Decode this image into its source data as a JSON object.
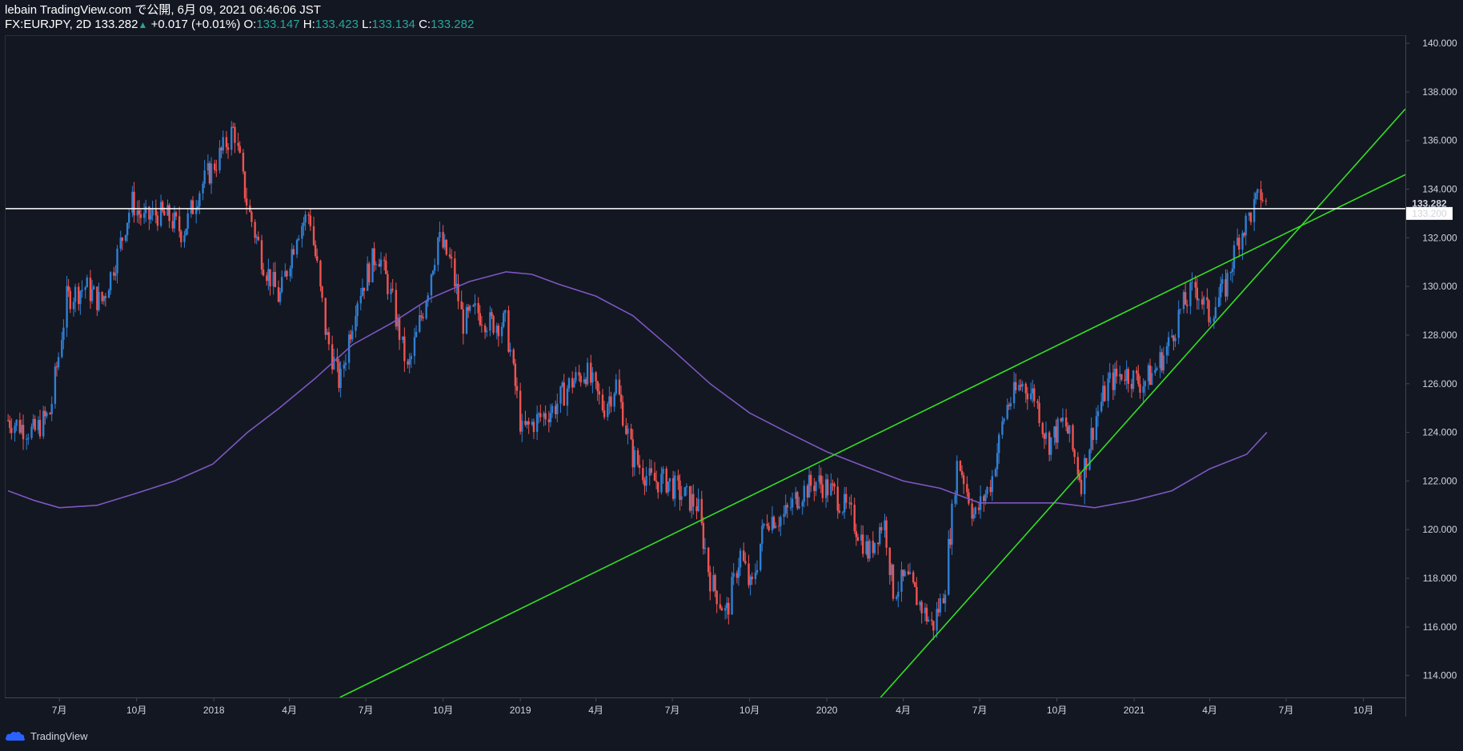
{
  "header": {
    "publish_line": "lebain TradingView.com で公開, 6月 09, 2021 06:46:06 JST",
    "symbol": "FX:EURJPY, 2D",
    "last": "133.282",
    "change": "+0.017 (+0.01%)",
    "o_label": "O:",
    "o_value": "133.147",
    "h_label": "H:",
    "h_value": "133.423",
    "l_label": "L:",
    "l_value": "133.134",
    "c_label": "C:",
    "c_value": "133.282"
  },
  "footer": {
    "brand": "TradingView"
  },
  "colors": {
    "background": "#131722",
    "up": "#2f7fd3",
    "down": "#ef5350",
    "ma": "#7e57c2",
    "trendline": "#34e024",
    "hline": "#ffffff"
  },
  "chart_data": {
    "type": "candlestick",
    "symbol": "FX:EURJPY",
    "interval": "2D",
    "y_ticks": [
      114,
      116,
      118,
      120,
      122,
      124,
      126,
      128,
      130,
      132,
      134,
      136,
      138,
      140
    ],
    "x_ticks": [
      "7月",
      "10月",
      "2018",
      "4月",
      "7月",
      "10月",
      "2019",
      "4月",
      "7月",
      "10月",
      "2020",
      "4月",
      "7月",
      "10月",
      "2021",
      "4月",
      "7月",
      "10月"
    ],
    "x_tick_dates": [
      "2017-07-01",
      "2017-10-01",
      "2018-01-01",
      "2018-04-01",
      "2018-07-01",
      "2018-10-01",
      "2019-01-01",
      "2019-04-01",
      "2019-07-01",
      "2019-10-01",
      "2020-01-01",
      "2020-04-01",
      "2020-07-01",
      "2020-10-01",
      "2021-01-01",
      "2021-04-01",
      "2021-07-01",
      "2021-10-01"
    ],
    "price_labels": [
      {
        "value": 133.282,
        "text": "133.282",
        "style": "current"
      },
      {
        "value": 133.2,
        "text": "133.200",
        "style": "line"
      }
    ],
    "price_path": [
      [
        "2017-05-01",
        124.5
      ],
      [
        "2017-06-01",
        124.0
      ],
      [
        "2017-06-20",
        124.8
      ],
      [
        "2017-07-10",
        129.5
      ],
      [
        "2017-08-01",
        130.0
      ],
      [
        "2017-08-20",
        129.3
      ],
      [
        "2017-09-10",
        131.5
      ],
      [
        "2017-09-25",
        133.5
      ],
      [
        "2017-10-10",
        132.7
      ],
      [
        "2017-10-25",
        133.0
      ],
      [
        "2017-11-10",
        132.8
      ],
      [
        "2017-11-25",
        132.2
      ],
      [
        "2017-12-15",
        134.0
      ],
      [
        "2018-01-10",
        135.5
      ],
      [
        "2018-01-25",
        136.5
      ],
      [
        "2018-02-10",
        133.3
      ],
      [
        "2018-03-01",
        131.0
      ],
      [
        "2018-03-20",
        129.5
      ],
      [
        "2018-04-10",
        132.3
      ],
      [
        "2018-04-25",
        133.0
      ],
      [
        "2018-05-15",
        128.0
      ],
      [
        "2018-05-31",
        126.0
      ],
      [
        "2018-06-20",
        129.5
      ],
      [
        "2018-07-15",
        131.5
      ],
      [
        "2018-08-01",
        129.5
      ],
      [
        "2018-08-20",
        126.5
      ],
      [
        "2018-09-10",
        129.5
      ],
      [
        "2018-09-25",
        132.0
      ],
      [
        "2018-10-10",
        131.0
      ],
      [
        "2018-10-25",
        128.5
      ],
      [
        "2018-11-10",
        129.0
      ],
      [
        "2018-11-25",
        128.5
      ],
      [
        "2018-12-15",
        128.5
      ],
      [
        "2019-01-03",
        124.0
      ],
      [
        "2019-01-20",
        124.5
      ],
      [
        "2019-02-10",
        125.0
      ],
      [
        "2019-03-01",
        126.0
      ],
      [
        "2019-03-20",
        126.5
      ],
      [
        "2019-04-10",
        125.0
      ],
      [
        "2019-04-25",
        126.0
      ],
      [
        "2019-05-15",
        123.0
      ],
      [
        "2019-06-05",
        122.0
      ],
      [
        "2019-06-25",
        122.0
      ],
      [
        "2019-07-10",
        121.5
      ],
      [
        "2019-07-31",
        121.0
      ],
      [
        "2019-08-15",
        118.0
      ],
      [
        "2019-09-03",
        116.5
      ],
      [
        "2019-09-20",
        119.0
      ],
      [
        "2019-10-03",
        117.5
      ],
      [
        "2019-10-20",
        120.5
      ],
      [
        "2019-11-10",
        120.5
      ],
      [
        "2019-11-30",
        121.5
      ],
      [
        "2019-12-20",
        122.0
      ],
      [
        "2020-01-10",
        121.5
      ],
      [
        "2020-01-31",
        120.5
      ],
      [
        "2020-02-20",
        119.0
      ],
      [
        "2020-03-09",
        120.5
      ],
      [
        "2020-03-20",
        117.5
      ],
      [
        "2020-04-05",
        118.0
      ],
      [
        "2020-04-20",
        117.0
      ],
      [
        "2020-05-06",
        116.0
      ],
      [
        "2020-05-20",
        117.5
      ],
      [
        "2020-06-05",
        123.0
      ],
      [
        "2020-06-25",
        120.5
      ],
      [
        "2020-07-15",
        122.0
      ],
      [
        "2020-08-01",
        125.0
      ],
      [
        "2020-08-20",
        126.0
      ],
      [
        "2020-09-05",
        125.5
      ],
      [
        "2020-09-20",
        123.5
      ],
      [
        "2020-10-10",
        124.5
      ],
      [
        "2020-10-30",
        122.0
      ],
      [
        "2020-11-15",
        124.5
      ],
      [
        "2020-12-01",
        126.0
      ],
      [
        "2020-12-20",
        126.5
      ],
      [
        "2021-01-10",
        126.0
      ],
      [
        "2021-01-25",
        126.5
      ],
      [
        "2021-02-10",
        127.5
      ],
      [
        "2021-02-25",
        129.0
      ],
      [
        "2021-03-15",
        130.0
      ],
      [
        "2021-03-31",
        128.8
      ],
      [
        "2021-04-20",
        130.0
      ],
      [
        "2021-05-05",
        132.0
      ],
      [
        "2021-05-20",
        133.0
      ],
      [
        "2021-06-01",
        133.8
      ],
      [
        "2021-06-08",
        133.28
      ]
    ],
    "moving_average": [
      [
        "2017-05-01",
        121.6
      ],
      [
        "2017-06-01",
        121.2
      ],
      [
        "2017-07-01",
        120.9
      ],
      [
        "2017-08-15",
        121.0
      ],
      [
        "2017-10-01",
        121.5
      ],
      [
        "2017-11-15",
        122.0
      ],
      [
        "2017-12-31",
        122.7
      ],
      [
        "2018-02-10",
        124.0
      ],
      [
        "2018-03-20",
        125.0
      ],
      [
        "2018-05-01",
        126.2
      ],
      [
        "2018-06-15",
        127.6
      ],
      [
        "2018-08-01",
        128.5
      ],
      [
        "2018-09-15",
        129.5
      ],
      [
        "2018-11-01",
        130.2
      ],
      [
        "2018-12-15",
        130.6
      ],
      [
        "2019-01-15",
        130.5
      ],
      [
        "2019-02-15",
        130.1
      ],
      [
        "2019-04-01",
        129.6
      ],
      [
        "2019-05-15",
        128.8
      ],
      [
        "2019-07-01",
        127.4
      ],
      [
        "2019-08-15",
        126.0
      ],
      [
        "2019-10-01",
        124.8
      ],
      [
        "2019-11-15",
        124.0
      ],
      [
        "2020-01-01",
        123.2
      ],
      [
        "2020-02-15",
        122.6
      ],
      [
        "2020-04-01",
        122.0
      ],
      [
        "2020-05-15",
        121.7
      ],
      [
        "2020-07-01",
        121.1
      ],
      [
        "2020-08-15",
        121.1
      ],
      [
        "2020-10-01",
        121.1
      ],
      [
        "2020-11-15",
        120.9
      ],
      [
        "2021-01-01",
        121.2
      ],
      [
        "2021-02-15",
        121.6
      ],
      [
        "2021-04-01",
        122.5
      ],
      [
        "2021-05-15",
        123.1
      ],
      [
        "2021-06-08",
        124.0
      ]
    ],
    "trendlines": [
      {
        "from": [
          "2018-05-31",
          113.1
        ],
        "to": [
          "2021-11-20",
          134.6
        ]
      },
      {
        "from": [
          "2020-03-05",
          113.1
        ],
        "to": [
          "2021-11-20",
          137.3
        ]
      }
    ],
    "horizontal_line": 133.2,
    "x_range": [
      "2017-04-28",
      "2021-11-20"
    ],
    "y_range": [
      113.1,
      140.3
    ]
  }
}
